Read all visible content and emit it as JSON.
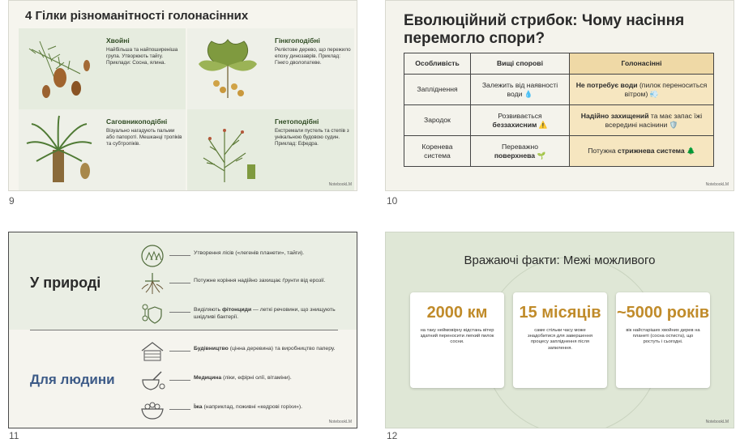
{
  "slide_numbers": [
    "9",
    "10",
    "11",
    "12"
  ],
  "watermark": "NotebookLM",
  "slide9": {
    "title": "4 Гілки різноманітності голонасінних",
    "cells": [
      {
        "title": "Хвойні",
        "desc": "Найбільша та найпоширеніша група. Утворюють тайгу. Приклади: Сосна, ялина."
      },
      {
        "title": "Гінкгоподібні",
        "desc": "Реліктове дерево, що пережило епоху динозаврів. Приклад: Гінкго дволопатеве."
      },
      {
        "title": "Саговникоподібні",
        "desc": "Візуально нагадують пальми або папороті. Мешканці тропіків та субтропіків."
      },
      {
        "title": "Гнетоподібні",
        "desc": "Екстремали пустель та степів з унікальною будовою судин. Приклад: Ефедра."
      }
    ]
  },
  "slide10": {
    "title": "Еволюційний стрибок: Чому насіння перемогло спори?",
    "headers": [
      "Особливість",
      "Вищі спорові",
      "Голонасінні"
    ],
    "rows": [
      {
        "feature": "Запліднення",
        "spore": "Залежить від наявності води 💧",
        "gymno_bold": "Не потребує води",
        "gymno_rest": " (пилок переноситься вітром) 💨"
      },
      {
        "feature": "Зародок",
        "spore_pre": "Розвивається ",
        "spore_bold": "беззахисним",
        "spore_post": " ⚠️",
        "gymno_bold": "Надійно захищений",
        "gymno_rest": " та має запас їжі всередині насінини 🛡️"
      },
      {
        "feature": "Коренева система",
        "spore_pre": "Переважно ",
        "spore_bold": "поверхнева",
        "spore_post": " 🌱",
        "gymno_pre": "Потужна ",
        "gymno_bold": "стрижнева система",
        "gymno_rest": " 🌲"
      }
    ]
  },
  "slide11": {
    "heading_nature": "У природі",
    "heading_human": "Для людини",
    "nature": [
      {
        "pre": "Утворення лісів («легенів планети», тайги).",
        "bold": "",
        "post": ""
      },
      {
        "pre": "Потужне коріння надійно захищає ґрунти від ерозії.",
        "bold": "",
        "post": ""
      },
      {
        "pre": "Виділяють ",
        "bold": "фітонциди",
        "post": " — леткі речовини, що знищують шкідливі бактерії."
      }
    ],
    "human": [
      {
        "pre": "",
        "bold": "Будівництво",
        "post": " (цінна деревина) та виробництво паперу."
      },
      {
        "pre": "",
        "bold": "Медицина",
        "post": " (ліки, ефірні олії, вітаміни)."
      },
      {
        "pre": "",
        "bold": "Їжа",
        "post": " (наприклад, поживні «кедрові горіхи»)."
      }
    ]
  },
  "slide12": {
    "title": "Вражаючі факти: Межі можливого",
    "cards": [
      {
        "big": "2000 км",
        "small": "на таку неймовірну відстань вітер здатний переносити легкий пилок сосни."
      },
      {
        "big": "15 місяців",
        "small": "саме стільки часу може знадобитися для завершення процесу запліднення після запилення."
      },
      {
        "big": "~5000 років",
        "small": "вік найстаріших хвойних дерев на планеті (сосна остиста), що ростуть і сьогодні."
      }
    ]
  },
  "colors": {
    "accent_gold": "#c08b2a",
    "green_dark": "#2e4a22",
    "blue_heading": "#3c5a87"
  }
}
